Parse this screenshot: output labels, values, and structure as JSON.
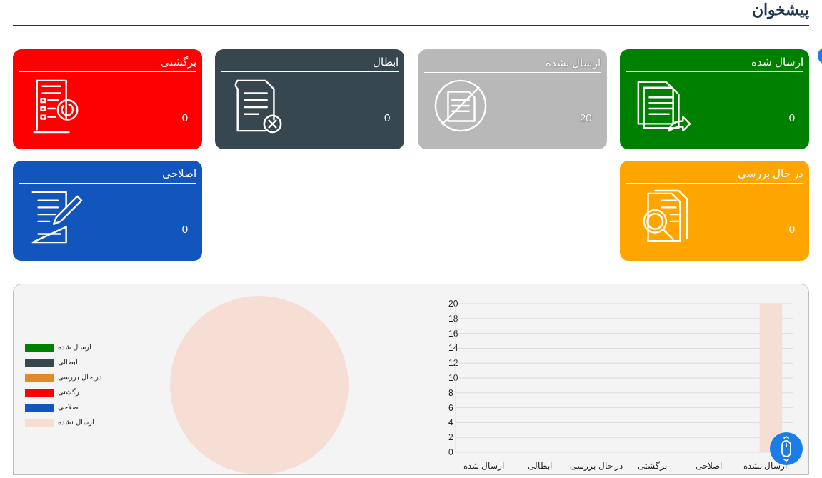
{
  "page_title": "پیشخوان",
  "cards": [
    {
      "title": "ارسال شده",
      "count": "0",
      "color": "#008000",
      "kind": "sent",
      "muted": false
    },
    {
      "title": "ارسال نشده",
      "count": "20",
      "color": "#b8b8b8",
      "kind": "unsent",
      "muted": true
    },
    {
      "title": "ابطال",
      "count": "0",
      "color": "#37474f",
      "kind": "cancel",
      "muted": false
    },
    {
      "title": "برگشتی",
      "count": "0",
      "color": "#ff0000",
      "kind": "returned",
      "muted": false
    },
    {
      "title": "در حال بررسی",
      "count": "0",
      "color": "#ffa500",
      "kind": "review",
      "muted": false
    },
    {
      "title": "اصلاحی",
      "count": "0",
      "color": "#1255bd",
      "kind": "edit",
      "muted": false
    }
  ],
  "pie": {
    "slices": [
      {
        "color": "#008000"
      },
      {
        "color": "#37474f"
      },
      {
        "color": "#e08a2a"
      },
      {
        "color": "#ff0000"
      },
      {
        "color": "#1255bd"
      },
      {
        "color": "#f7ded4"
      }
    ],
    "chart_data": {
      "type": "pie",
      "categories": [
        "ارسال شده",
        "ابطالی",
        "در حال بررسی",
        "برگشتی",
        "اصلاحی",
        "ارسال نشده"
      ],
      "values": [
        0,
        0,
        0,
        0,
        0,
        100
      ]
    }
  },
  "bar": {
    "chart_data": {
      "type": "bar",
      "categories": [
        "ارسال شده",
        "ابطالی",
        "در حال بررسی",
        "برگشتی",
        "اصلاحی",
        "ارسال نشده"
      ],
      "values": [
        0,
        0,
        0,
        0,
        0,
        20
      ],
      "ylim": [
        0,
        20
      ],
      "yticks": [
        0,
        2,
        4,
        6,
        8,
        10,
        12,
        14,
        16,
        18,
        20
      ],
      "grid": true
    }
  }
}
